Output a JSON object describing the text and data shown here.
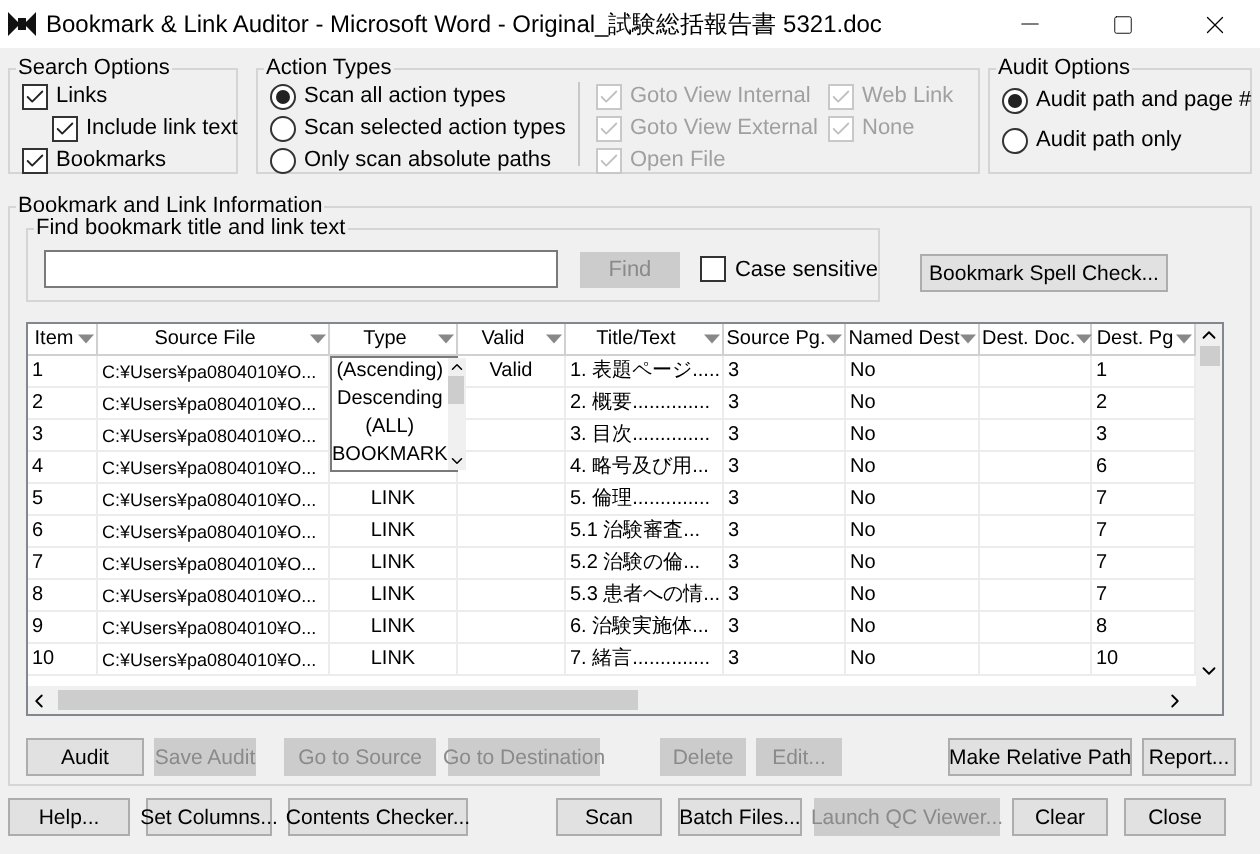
{
  "window": {
    "title": "Bookmark & Link Auditor - Microsoft Word - Original_試験総括報告書 5321.doc"
  },
  "search_options": {
    "title": "Search Options",
    "items": [
      {
        "label": "Links",
        "checked": true,
        "indented": false
      },
      {
        "label": "Include link text",
        "checked": true,
        "indented": true
      },
      {
        "label": "Bookmarks",
        "checked": true,
        "indented": false
      }
    ]
  },
  "action_types": {
    "title": "Action Types",
    "radios": [
      {
        "label": "Scan all action types",
        "selected": true
      },
      {
        "label": "Scan selected action types",
        "selected": false
      },
      {
        "label": "Only scan absolute paths",
        "selected": false
      }
    ],
    "checks": [
      {
        "label": "Goto View Internal",
        "checked": true,
        "disabled": true
      },
      {
        "label": "Web Link",
        "checked": true,
        "disabled": true
      },
      {
        "label": "Goto View External",
        "checked": true,
        "disabled": true
      },
      {
        "label": "None",
        "checked": true,
        "disabled": true
      },
      {
        "label": "Open File",
        "checked": true,
        "disabled": true
      }
    ]
  },
  "audit_options": {
    "title": "Audit Options",
    "radios": [
      {
        "label": "Audit path and page #",
        "selected": true
      },
      {
        "label": "Audit path only",
        "selected": false
      }
    ]
  },
  "info": {
    "title": "Bookmark and Link Information",
    "find": {
      "title": "Find bookmark title and link text",
      "button": {
        "label": "Find",
        "disabled": true
      },
      "case_sensitive": {
        "label": "Case sensitive",
        "checked": false
      }
    },
    "spell_button": "Bookmark Spell Check...",
    "table": {
      "columns": [
        "Item",
        "Source File",
        "Type",
        "Valid",
        "Title/Text",
        "Source Pg.",
        "Named Dest",
        "Dest. Doc.",
        "Dest. Pg"
      ],
      "rows": [
        [
          "1",
          "C:¥Users¥pa0804010¥O...",
          "",
          "Valid",
          "1. 表題ページ.....",
          "3",
          "No",
          "",
          "1"
        ],
        [
          "2",
          "C:¥Users¥pa0804010¥O...",
          "",
          "",
          "2. 概要..............",
          "3",
          "No",
          "",
          "2"
        ],
        [
          "3",
          "C:¥Users¥pa0804010¥O...",
          "",
          "",
          "3. 目次..............",
          "3",
          "No",
          "",
          "3"
        ],
        [
          "4",
          "C:¥Users¥pa0804010¥O...",
          "",
          "",
          "4. 略号及び用...",
          "3",
          "No",
          "",
          "6"
        ],
        [
          "5",
          "C:¥Users¥pa0804010¥O...",
          "LINK",
          "",
          "5. 倫理..............",
          "3",
          "No",
          "",
          "7"
        ],
        [
          "6",
          "C:¥Users¥pa0804010¥O...",
          "LINK",
          "",
          "5.1 治験審査...",
          "3",
          "No",
          "",
          "7"
        ],
        [
          "7",
          "C:¥Users¥pa0804010¥O...",
          "LINK",
          "",
          "5.2 治験の倫...",
          "3",
          "No",
          "",
          "7"
        ],
        [
          "8",
          "C:¥Users¥pa0804010¥O...",
          "LINK",
          "",
          "5.3 患者への情...",
          "3",
          "No",
          "",
          "7"
        ],
        [
          "9",
          "C:¥Users¥pa0804010¥O...",
          "LINK",
          "",
          "6. 治験実施体...",
          "3",
          "No",
          "",
          "8"
        ],
        [
          "10",
          "C:¥Users¥pa0804010¥O...",
          "LINK",
          "",
          "7. 緒言..............",
          "3",
          "No",
          "",
          "10"
        ]
      ],
      "type_dropdown": [
        "(Ascending)",
        "Descending",
        "(ALL)",
        "BOOKMARK"
      ]
    },
    "actions": [
      {
        "label": "Audit",
        "disabled": false
      },
      {
        "label": "Save Audit",
        "disabled": true
      },
      {
        "label": "Go to Source",
        "disabled": true
      },
      {
        "label": "Go to Destination",
        "disabled": true
      },
      {
        "label": "Delete",
        "disabled": true
      },
      {
        "label": "Edit...",
        "disabled": true
      },
      {
        "label": "Make Relative Path",
        "disabled": false
      },
      {
        "label": "Report...",
        "disabled": false
      }
    ]
  },
  "buttons": [
    {
      "label": "Help...",
      "disabled": false
    },
    {
      "label": "Set Columns...",
      "disabled": false
    },
    {
      "label": "Contents Checker...",
      "disabled": false
    },
    {
      "label": "Scan",
      "disabled": false
    },
    {
      "label": "Batch Files...",
      "disabled": false
    },
    {
      "label": "Launch QC Viewer...",
      "disabled": true
    },
    {
      "label": "Clear",
      "disabled": false
    },
    {
      "label": "Close",
      "disabled": false
    }
  ]
}
